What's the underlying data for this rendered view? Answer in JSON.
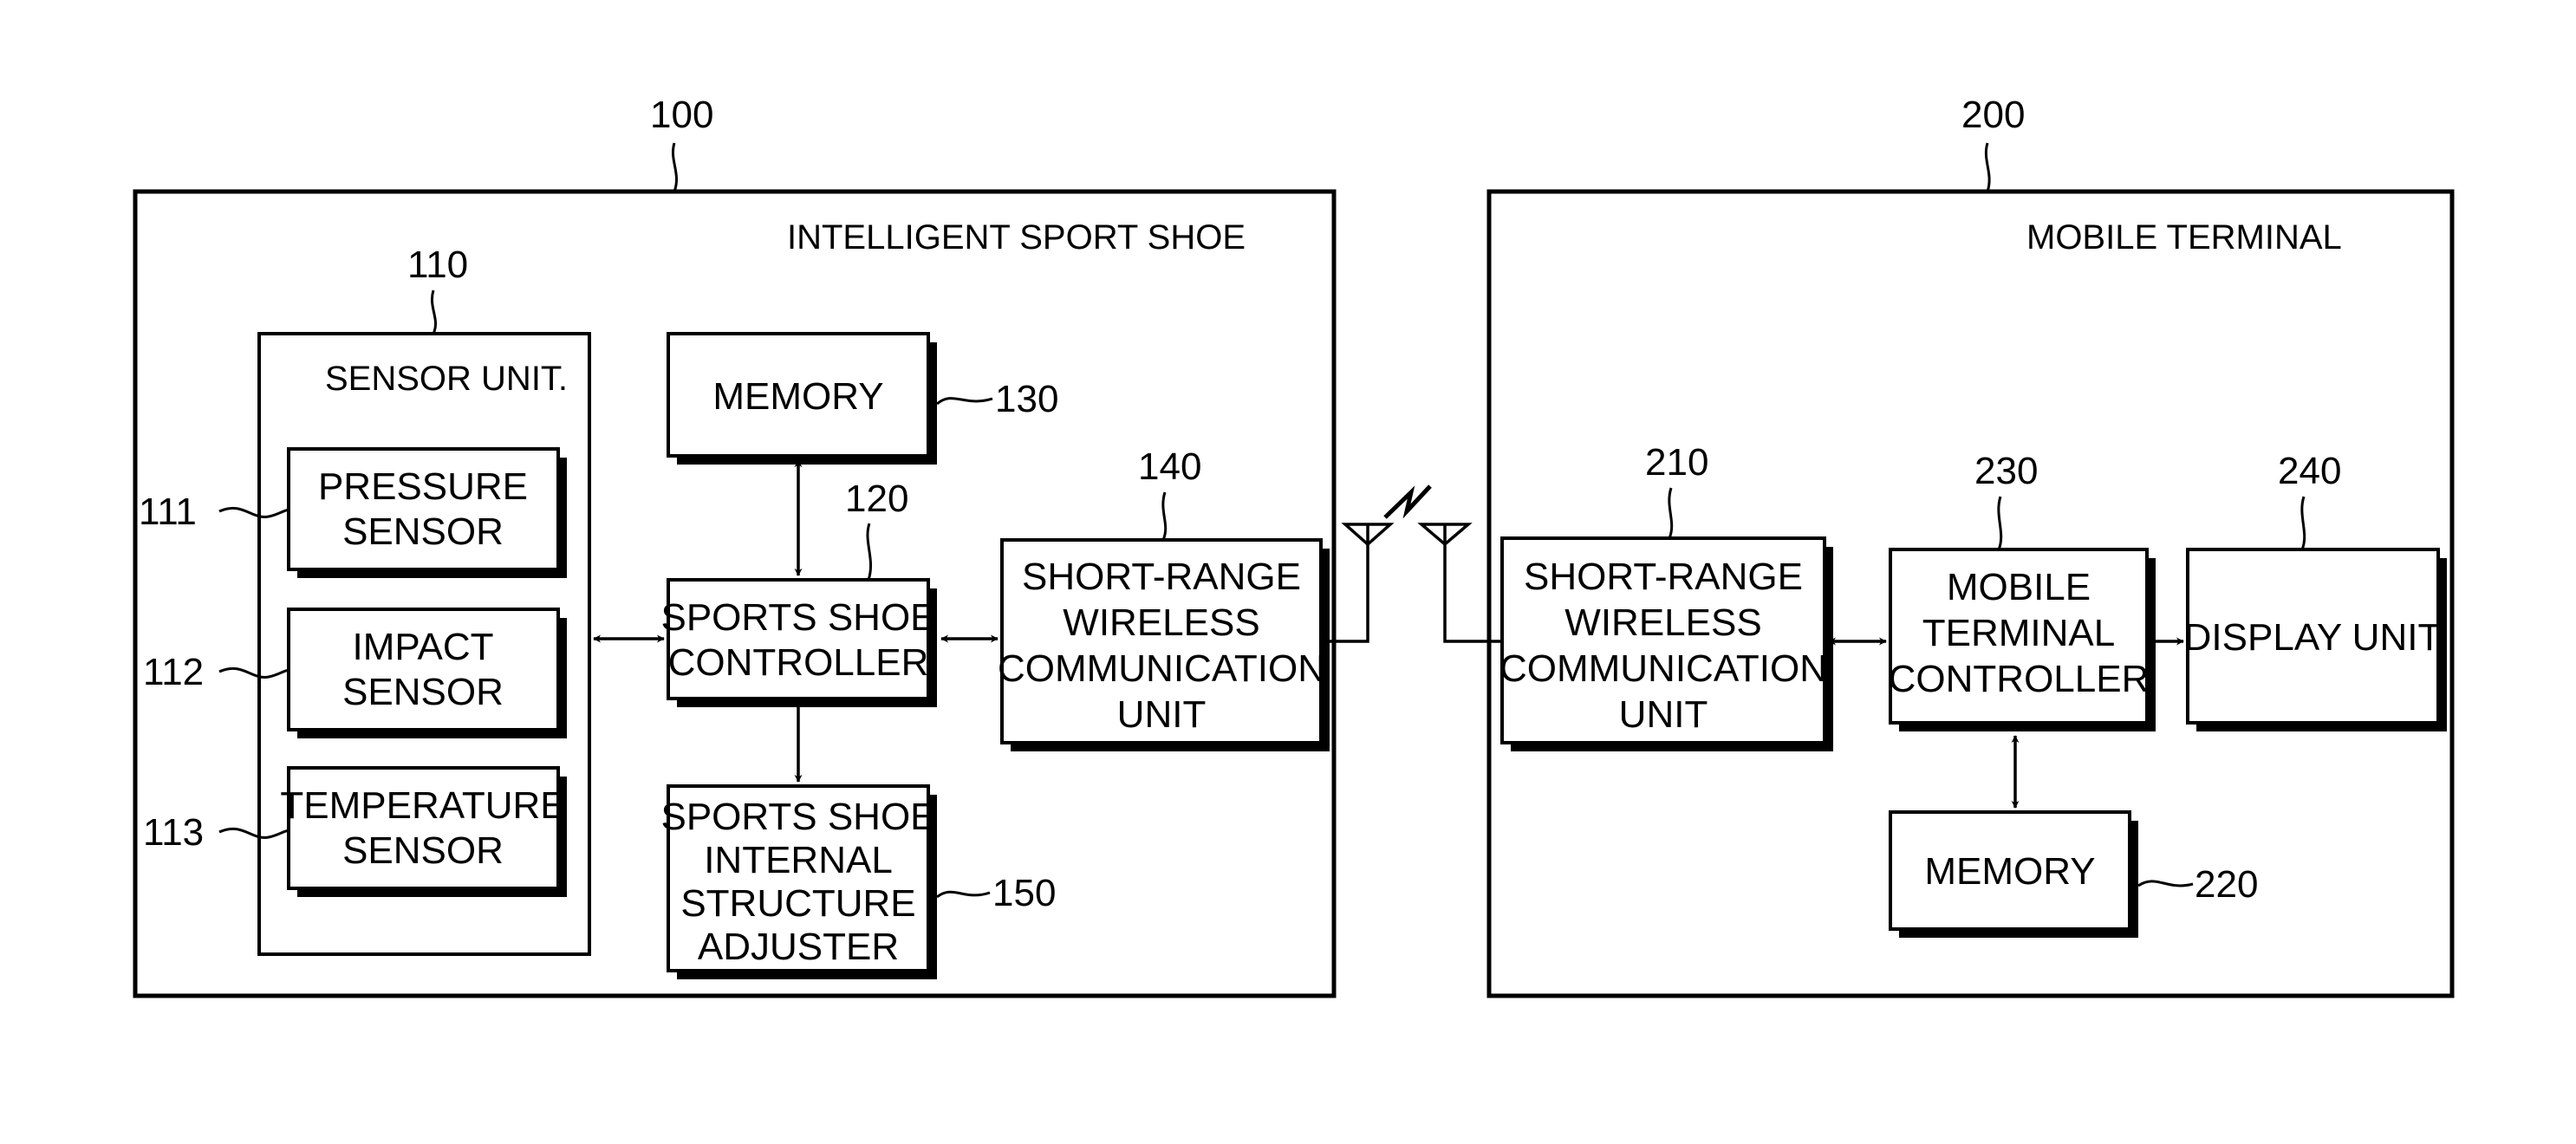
{
  "shoe": {
    "ref": "100",
    "title": "INTELLIGENT SPORT SHOE",
    "sensor_unit": {
      "ref": "110",
      "title": "SENSOR UNIT.",
      "sensors": [
        {
          "ref": "111",
          "lines": [
            "PRESSURE",
            "SENSOR"
          ]
        },
        {
          "ref": "112",
          "lines": [
            "IMPACT",
            "SENSOR"
          ]
        },
        {
          "ref": "113",
          "lines": [
            "TEMPERATURE",
            "SENSOR"
          ]
        }
      ]
    },
    "memory": {
      "ref": "130",
      "lines": [
        "MEMORY"
      ]
    },
    "controller": {
      "ref": "120",
      "lines": [
        "SPORTS SHOE",
        "CONTROLLER"
      ]
    },
    "adjuster": {
      "ref": "150",
      "lines": [
        "SPORTS SHOE",
        "INTERNAL",
        "STRUCTURE",
        "ADJUSTER"
      ]
    },
    "wireless": {
      "ref": "140",
      "lines": [
        "SHORT-RANGE",
        "WIRELESS",
        "COMMUNICATION",
        "UNIT"
      ]
    }
  },
  "mobile": {
    "ref": "200",
    "title": "MOBILE TERMINAL",
    "wireless": {
      "ref": "210",
      "lines": [
        "SHORT-RANGE",
        "WIRELESS",
        "COMMUNICATION",
        "UNIT"
      ]
    },
    "controller": {
      "ref": "230",
      "lines": [
        "MOBILE",
        "TERMINAL",
        "CONTROLLER"
      ]
    },
    "display": {
      "ref": "240",
      "lines": [
        "DISPLAY UNIT"
      ]
    },
    "memory": {
      "ref": "220",
      "lines": [
        "MEMORY"
      ]
    }
  },
  "icons": {
    "antenna": "antenna-icon",
    "wireless_link": "lightning-bolt-icon"
  }
}
